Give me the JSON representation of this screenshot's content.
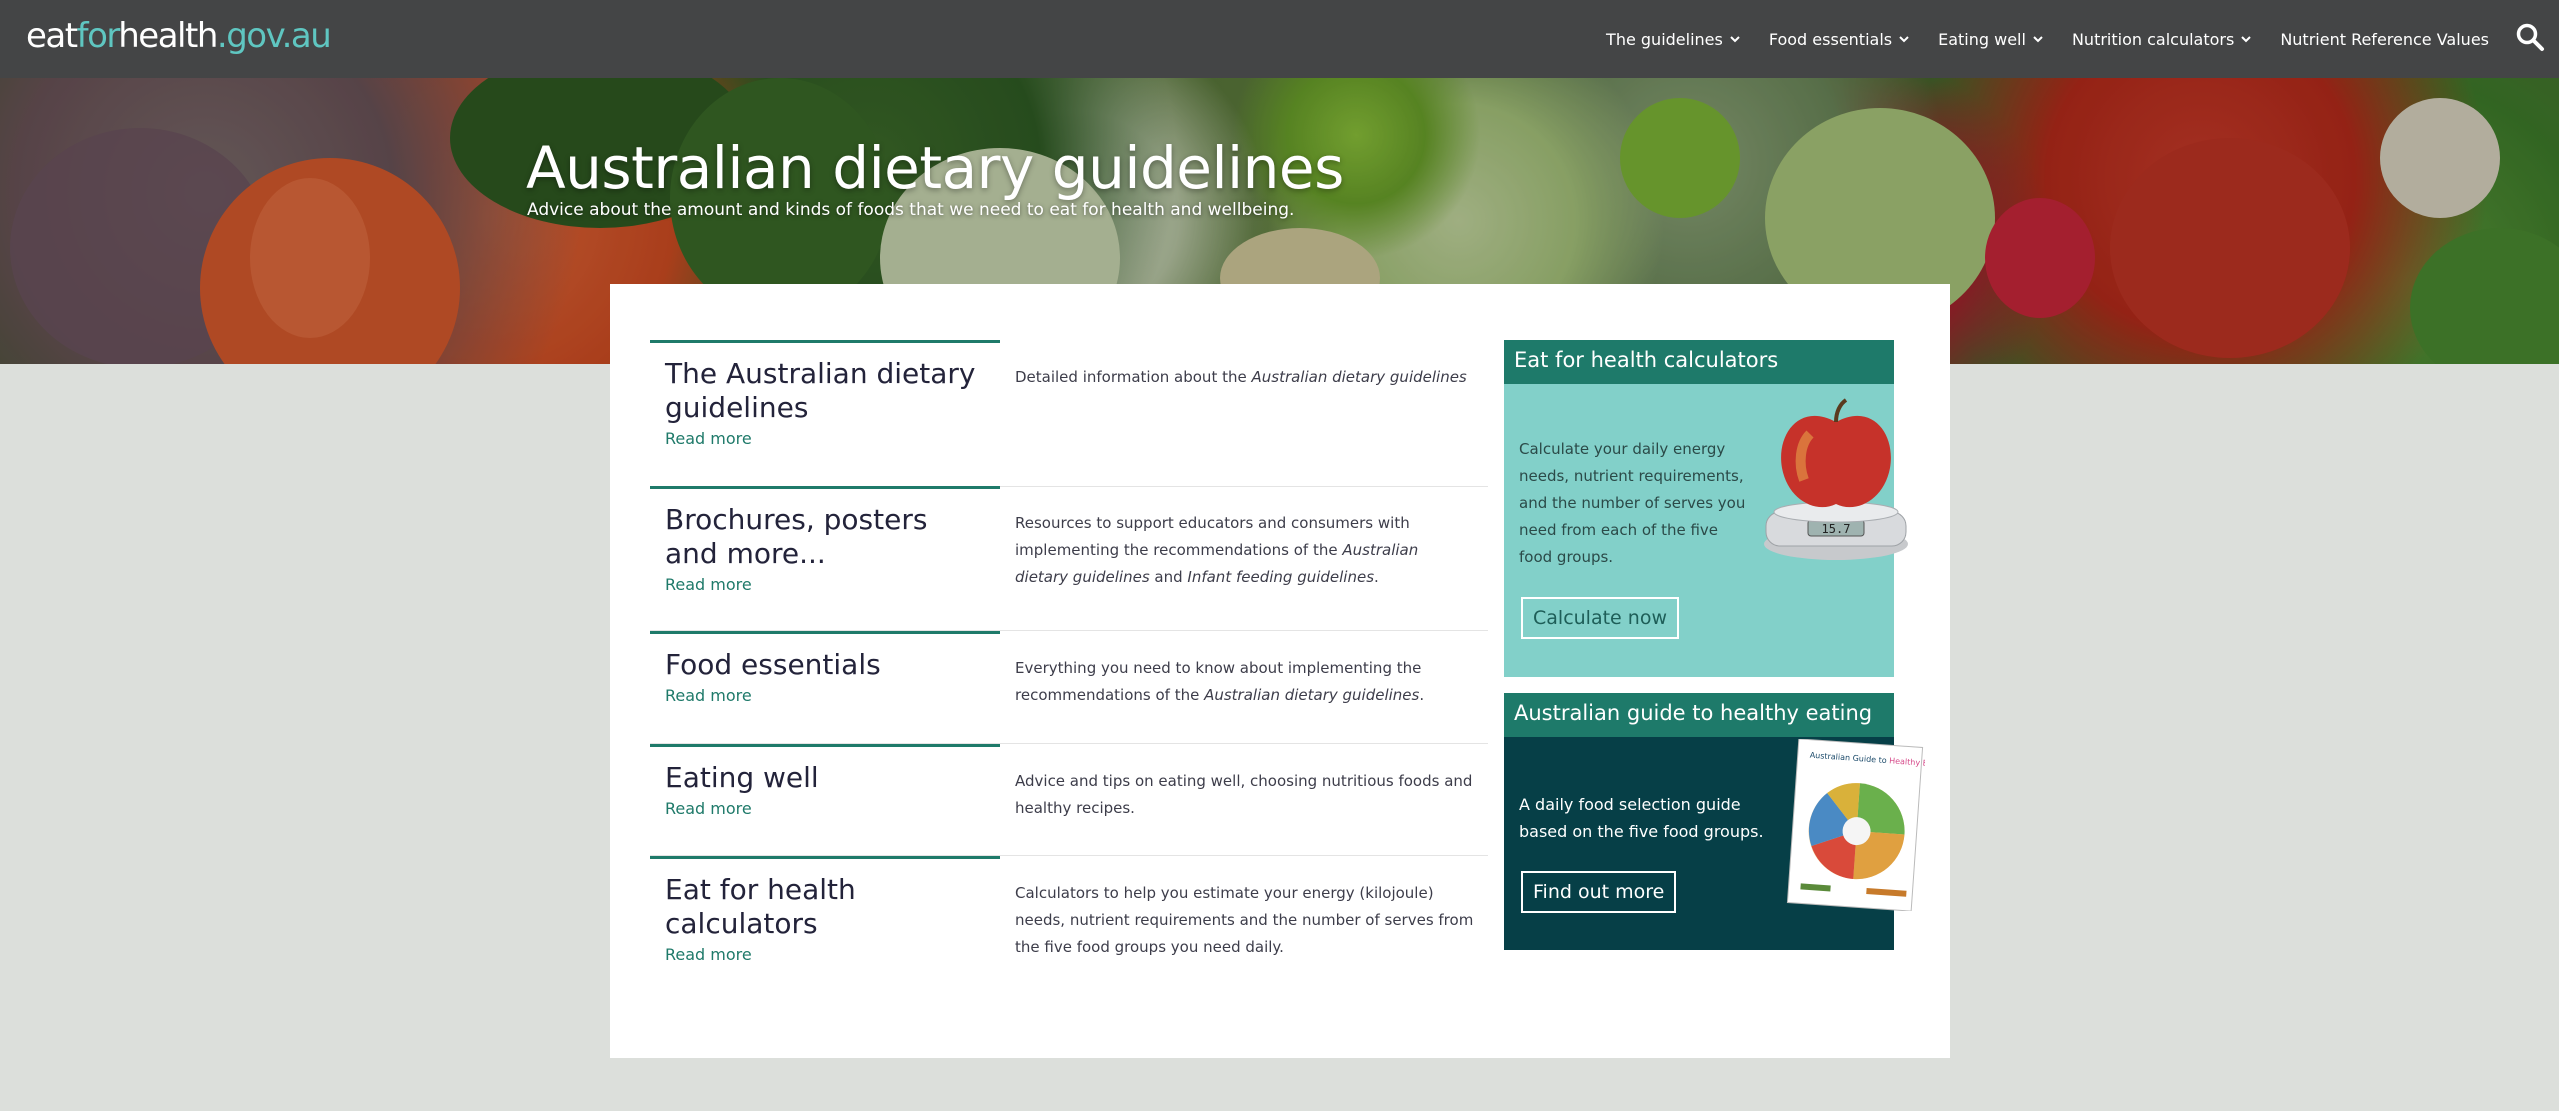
{
  "logo": {
    "part1": "eat",
    "part2": "for",
    "part3": "health",
    "part4": ".gov.au"
  },
  "nav": {
    "items": [
      {
        "label": "The guidelines",
        "dropdown": true
      },
      {
        "label": "Food essentials",
        "dropdown": true
      },
      {
        "label": "Eating well",
        "dropdown": true
      },
      {
        "label": "Nutrition calculators",
        "dropdown": true
      },
      {
        "label": "Nutrient Reference Values",
        "dropdown": false
      }
    ],
    "search_icon": "search-icon"
  },
  "hero": {
    "title": "Australian dietary guidelines",
    "subtitle": "Advice about the amount and kinds of foods that we need to eat for health and wellbeing."
  },
  "rows": [
    {
      "title_line1": "The Australian dietary",
      "title_line2": "guidelines",
      "read_more": "Read more",
      "desc_a": "Detailed information about the ",
      "desc_b": "Australian dietary guidelines",
      "desc_c": "",
      "desc_d": "",
      "desc_e": ""
    },
    {
      "title_line1": "Brochures, posters",
      "title_line2": "and more...",
      "read_more": "Read more",
      "desc_a": "Resources to support educators and consumers with implementing the recommendations of the ",
      "desc_b": "Australian dietary guidelines",
      "desc_c": " and ",
      "desc_d": "Infant feeding guidelines",
      "desc_e": "."
    },
    {
      "title_line1": "Food essentials",
      "title_line2": "",
      "read_more": "Read more",
      "desc_a": "Everything you need to know about implementing the recommendations of the ",
      "desc_b": "Australian dietary guidelines",
      "desc_c": ".",
      "desc_d": "",
      "desc_e": ""
    },
    {
      "title_line1": "Eating well",
      "title_line2": "",
      "read_more": "Read more",
      "desc_a": "Advice and tips on eating well, choosing nutritious foods and healthy recipes.",
      "desc_b": "",
      "desc_c": "",
      "desc_d": "",
      "desc_e": ""
    },
    {
      "title_line1": "Eat for health",
      "title_line2": "calculators",
      "read_more": "Read more",
      "desc_a": "Calculators to help you estimate your energy (kilojoule) needs, nutrient requirements and the number of serves from the five food groups you need daily.",
      "desc_b": "",
      "desc_c": "",
      "desc_d": "",
      "desc_e": ""
    }
  ],
  "card_calculators": {
    "header": "Eat for health calculators",
    "text": "Calculate your daily energy needs, nutrient requirements, and the number of serves you need from each of the five food groups.",
    "button": "Calculate now",
    "scale_readout": "15.7"
  },
  "card_guide": {
    "header": "Australian guide to healthy eating",
    "text": "A daily food selection guide based on the five food groups.",
    "button": "Find out more",
    "poster_title_a": "Australian Guide to ",
    "poster_title_b": "Healthy Eating"
  },
  "colors": {
    "nav_bg": "#444546",
    "accent": "#1f7a6a",
    "teal_light": "#82d0c9",
    "teal_dark": "#063f47",
    "logo_accent": "#5fc6c1"
  }
}
